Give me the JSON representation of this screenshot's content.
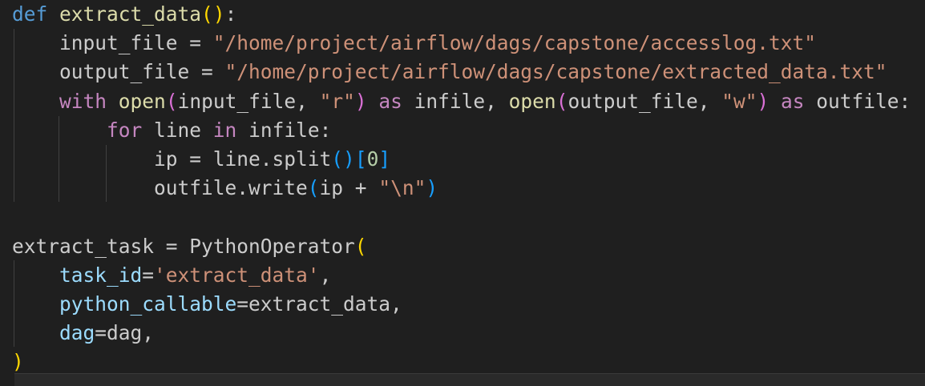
{
  "editor": {
    "language": "python",
    "lines": [
      [
        "def",
        " ",
        "extract_data",
        "(",
        ")",
        ":"
      ],
      [
        "    ",
        "input_file",
        " = ",
        "\"/home/project/airflow/dags/capstone/accesslog.txt\""
      ],
      [
        "    ",
        "output_file",
        " = ",
        "\"/home/project/airflow/dags/capstone/extracted_data.txt\""
      ],
      [
        "    ",
        "with",
        " ",
        "open",
        "(",
        "input_file, ",
        "\"r\"",
        ")",
        " ",
        "as",
        " infile, ",
        "open",
        "(",
        "output_file, ",
        "\"w\"",
        ")",
        " ",
        "as",
        " outfile:"
      ],
      [
        "        ",
        "for",
        " line ",
        "in",
        " infile:"
      ],
      [
        "            ",
        "ip = line.split",
        "(",
        ")",
        "[",
        "0",
        "]"
      ],
      [
        "            ",
        "outfile.write",
        "(",
        "ip + ",
        "\"\\n\"",
        ")"
      ],
      [
        ""
      ],
      [
        "extract_task = PythonOperator",
        "("
      ],
      [
        "    ",
        "task_id",
        "=",
        "'extract_data'",
        ","
      ],
      [
        "    ",
        "python_callable",
        "=extract_data,"
      ],
      [
        "    ",
        "dag",
        "=dag,"
      ],
      [
        ")"
      ]
    ]
  }
}
